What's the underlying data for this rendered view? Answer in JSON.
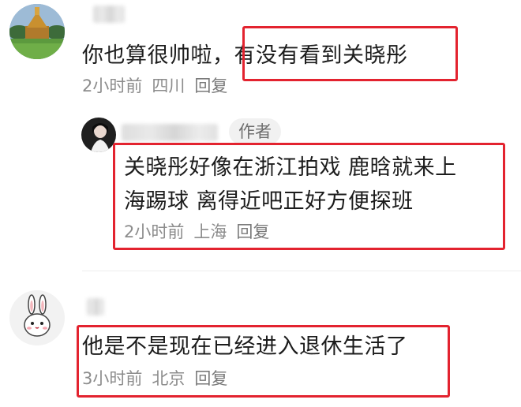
{
  "colors": {
    "highlight_box": "#e3232f",
    "meta_text": "#8c8c8c",
    "body_text": "#1c1c1c"
  },
  "comments": [
    {
      "avatar_icon": "temple-landscape-avatar-icon",
      "text_before": "你也算很帅啦，",
      "text_highlighted": "有没有看到关晓彤",
      "time": "2小时前",
      "location": "四川",
      "reply_label": "回复",
      "replies": [
        {
          "avatar_icon": "dark-portrait-avatar-icon",
          "author_tag": "作者",
          "text_line1": "关晓彤好像在浙江拍戏 鹿晗就来上",
          "text_line2": "海踢球 离得近吧正好方便探班",
          "time": "2小时前",
          "location": "上海",
          "reply_label": "回复"
        }
      ]
    },
    {
      "avatar_icon": "bunny-avatar-icon",
      "text": "他是不是现在已经进入退休生活了",
      "time": "3小时前",
      "location": "北京",
      "reply_label": "回复"
    }
  ]
}
